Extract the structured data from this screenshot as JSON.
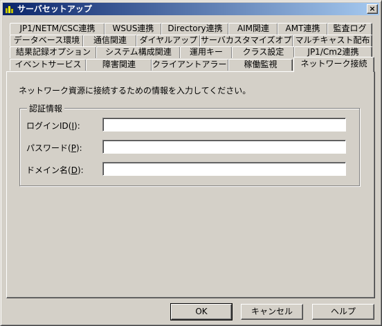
{
  "window": {
    "title": "サーバセットアップ",
    "close_label": "×"
  },
  "tabs": {
    "row1": [
      "JP1/NETM/CSC連携",
      "WSUS連携",
      "Directory連携",
      "AIM関連",
      "AMT連携",
      "監査ログ"
    ],
    "row2": [
      "データベース環境",
      "通信関連",
      "ダイヤルアップ",
      "サーバカスタマイズオプション",
      "マルチキャスト配布"
    ],
    "row3": [
      "結果記録オプション",
      "システム構成関連",
      "運用キー",
      "クラス設定",
      "JP1/Cm2連携"
    ],
    "row4": [
      "イベントサービス",
      "障害関連",
      "クライアントアラート",
      "稼働監視",
      "ネットワーク接続"
    ],
    "active": "ネットワーク接続"
  },
  "panel": {
    "instruction": "ネットワーク資源に接続するための情報を入力してください。",
    "group_title": "認証情報",
    "fields": [
      {
        "label": "ログインID",
        "mnemonic": "I",
        "value": ""
      },
      {
        "label": "パスワード",
        "mnemonic": "P",
        "value": ""
      },
      {
        "label": "ドメイン名",
        "mnemonic": "D",
        "value": ""
      }
    ]
  },
  "buttons": {
    "ok": "OK",
    "cancel": "キャンセル",
    "help": "ヘルプ"
  }
}
